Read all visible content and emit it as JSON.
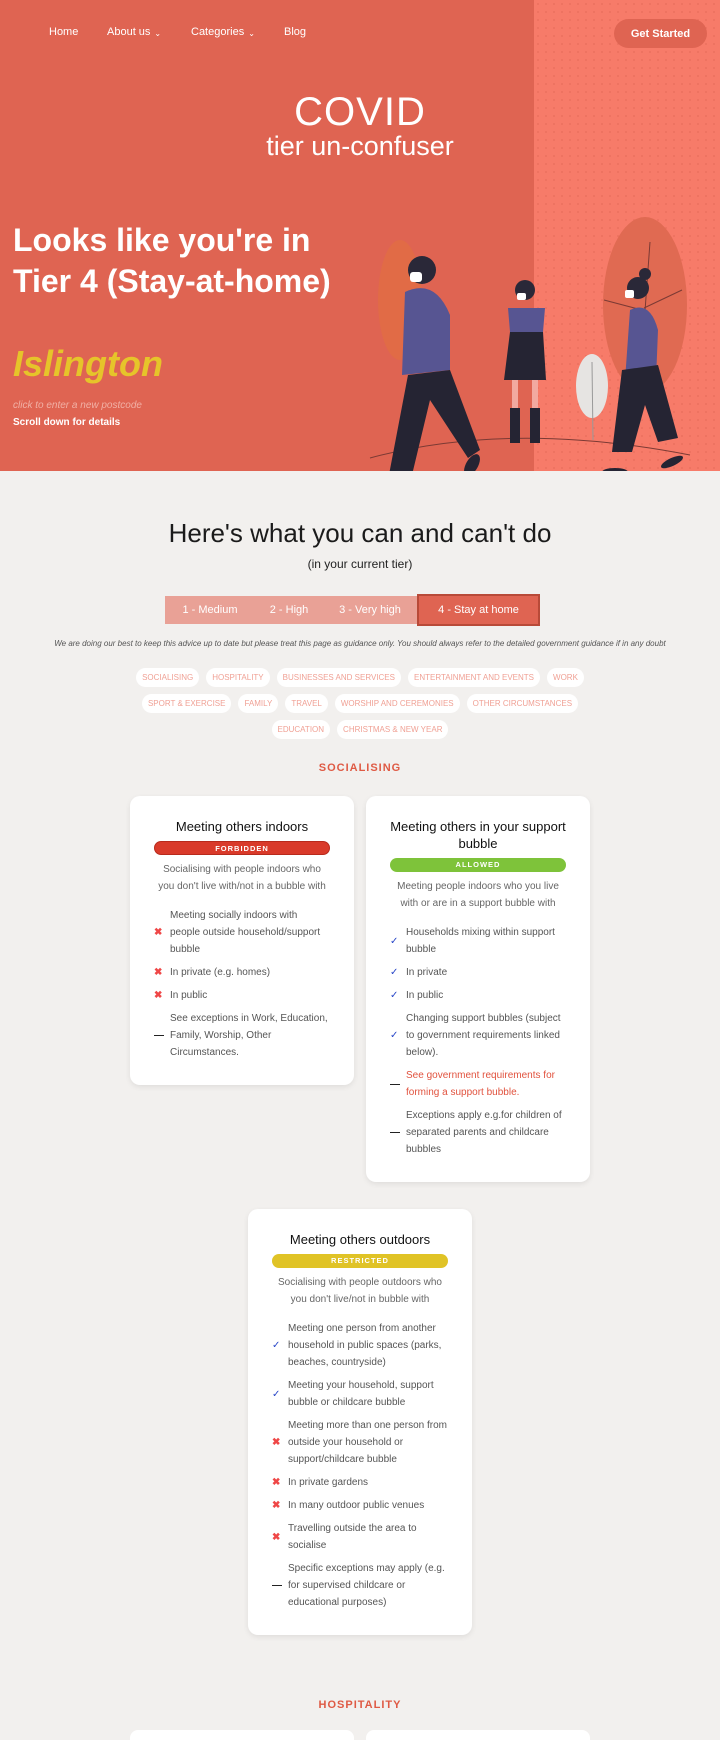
{
  "nav": {
    "items": [
      {
        "label": "Home",
        "has_dropdown": false
      },
      {
        "label": "About us",
        "has_dropdown": true
      },
      {
        "label": "Categories",
        "has_dropdown": true
      },
      {
        "label": "Blog",
        "has_dropdown": false
      }
    ],
    "cta": "Get Started"
  },
  "brand": {
    "line1": "COVID",
    "line2": "tier un-confuser"
  },
  "hero": {
    "headline": "Looks like you're in Tier 4 (Stay-at-home)",
    "region": "Islington",
    "postcode_link": "click to enter a new postcode",
    "scroll_hint": "Scroll down for details"
  },
  "main": {
    "title": "Here's what you can and can't do",
    "subtitle": "(in your current tier)",
    "tiers": [
      {
        "label": "1 - Medium",
        "active": false
      },
      {
        "label": "2 - High",
        "active": false
      },
      {
        "label": "3 - Very high",
        "active": false
      },
      {
        "label": "4 - Stay at home",
        "active": true
      }
    ],
    "disclaimer": "We are doing our best to keep this advice up to date but please treat this page as guidance only. You should always refer to the detailed government guidance if in any doubt",
    "categories": [
      [
        "SOCIALISING",
        "HOSPITALITY",
        "BUSINESSES AND SERVICES",
        "ENTERTAINMENT AND EVENTS",
        "WORK"
      ],
      [
        "SPORT & EXERCISE",
        "FAMILY",
        "TRAVEL",
        "WORSHIP AND CEREMONIES",
        "OTHER CIRCUMSTANCES"
      ],
      [
        "EDUCATION",
        "CHRISTMAS & NEW YEAR"
      ]
    ]
  },
  "sections": [
    {
      "title": "SOCIALISING",
      "cards": [
        {
          "title": "Meeting others indoors",
          "status": "FORBIDDEN",
          "description": "Socialising with people indoors who you don't live with/not in a bubble with",
          "rules": [
            {
              "icon": "cross",
              "text": "Meeting socially indoors with people outside household/support bubble"
            },
            {
              "icon": "cross",
              "text": "In private (e.g. homes)"
            },
            {
              "icon": "cross",
              "text": "In public"
            },
            {
              "icon": "dash",
              "text": "See exceptions in Work, Education, Family, Worship, Other Circumstances."
            }
          ]
        },
        {
          "title": "Meeting others in your support bubble",
          "status": "ALLOWED",
          "description": "Meeting people indoors who you live with or are in a support bubble with",
          "rules": [
            {
              "icon": "check",
              "text": "Households mixing within support bubble"
            },
            {
              "icon": "check",
              "text": "In private"
            },
            {
              "icon": "check",
              "text": "In public"
            },
            {
              "icon": "check",
              "text": "Changing support bubbles (subject to government requirements linked below)."
            },
            {
              "icon": "dash",
              "text": "See government requirements for forming a support bubble.",
              "link": true
            },
            {
              "icon": "dash",
              "text": "Exceptions apply e.g.for children of separated parents and childcare bubbles"
            }
          ]
        },
        {
          "title": "Meeting others outdoors",
          "status": "RESTRICTED",
          "description": "Socialising with people outdoors who you don't live/not in bubble with",
          "rules": [
            {
              "icon": "check",
              "text": "Meeting one person from another household in public spaces (parks, beaches, countryside)"
            },
            {
              "icon": "check",
              "text": "Meeting your household, support bubble or childcare bubble"
            },
            {
              "icon": "cross",
              "text": "Meeting more than one person from outside your household or support/childcare bubble"
            },
            {
              "icon": "cross",
              "text": "In private gardens"
            },
            {
              "icon": "cross",
              "text": "In many outdoor public venues"
            },
            {
              "icon": "cross",
              "text": "Travelling outside the area to socialise"
            },
            {
              "icon": "dash",
              "text": "Specific exceptions may apply (e.g. for supervised childcare or educational purposes)"
            }
          ]
        }
      ]
    },
    {
      "title": "HOSPITALITY"
    }
  ],
  "icons": {
    "cross": "✖",
    "check": "✓",
    "dash": "—",
    "chevron": "⌄"
  },
  "colors": {
    "hero_bg": "#df6452",
    "hero_accent": "#f77b69",
    "region_text": "#e6c42a",
    "forbidden": "#d93a2a",
    "allowed": "#7ec33a",
    "restricted": "#e0c326",
    "category_title": "#df5a44"
  }
}
